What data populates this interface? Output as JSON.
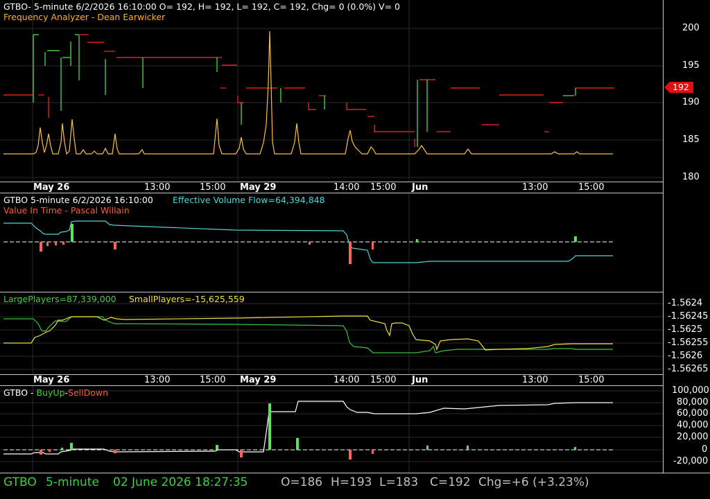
{
  "symbol": "GTBO",
  "panes": {
    "price": {
      "header": "GTBO- 5-minute 6/2/2026 16:10:00 O= 192, H= 192, L= 192, C= 192, Chg= 0 (0.0%) V= 0",
      "indicator": "Frequency Analyzer - Dean Earwicker",
      "scale": [
        "200",
        "195",
        "190",
        "185",
        "180"
      ],
      "last_price_tag": "192"
    },
    "volume_flow": {
      "header_main": "GTBO 5-minute  6/2/2026 16:10:00",
      "header_value": "Effective Volume Flow=64,394,848",
      "indicator": "Value In Time - Pascal Willain"
    },
    "players": {
      "large": "LargePlayers=87,339,000",
      "small": "SmallPlayers=-15,625,559",
      "scale": [
        "-1.5624",
        "-1.56245",
        "-1.5625",
        "-1.56255",
        "-1.5626",
        "-1.56265"
      ]
    },
    "buyup": {
      "label_prefix": "GTBO - ",
      "buy": "BuyUp",
      "sep": "-",
      "sell": "SellDown",
      "scale": [
        "100,000",
        "80,000",
        "60,000",
        "40,000",
        "20,000",
        "0",
        "-20,000"
      ]
    }
  },
  "time_axis": [
    "May 26",
    "13:00",
    "15:00",
    "May 29",
    "14:00",
    "15:00",
    "Jun",
    "13:00",
    "15:00"
  ],
  "status_bar": {
    "symbol": "GTBO",
    "interval": "5-minute",
    "datetime": "02 June 2026 18:27:35",
    "open": "O=186",
    "high": "H=193",
    "low": "L=183",
    "close": "C=192",
    "change": "Chg=+6 (+3.23%)"
  },
  "colors": {
    "background": "#000000",
    "grid": "#2a2a2a",
    "up": "#40d040",
    "down": "#e02020",
    "frequency": "#ffc040",
    "large_players": "#40c040",
    "small_players": "#f0e040",
    "flow": "#4fd6d6"
  }
}
